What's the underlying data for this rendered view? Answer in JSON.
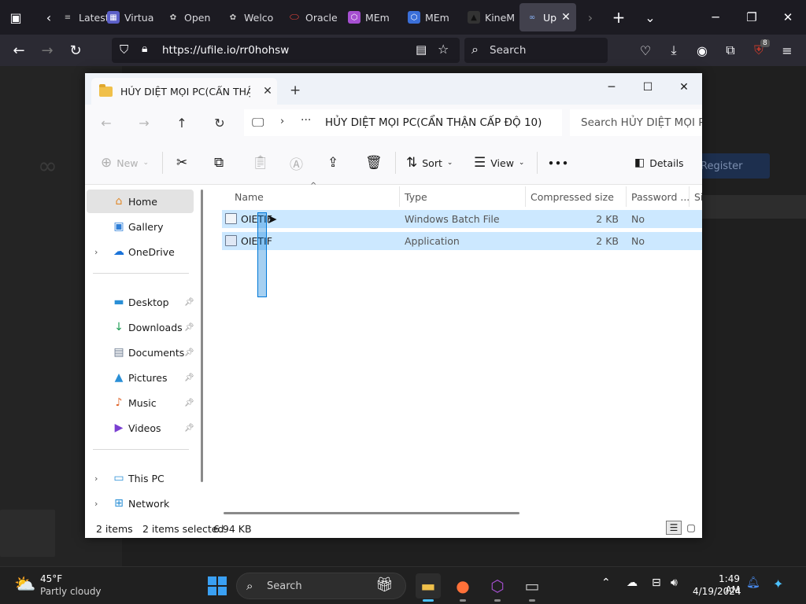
{
  "browser": {
    "tabs": [
      {
        "label": "Latest",
        "icon": "list-icon"
      },
      {
        "label": "Virtua",
        "icon": "virtualbox-icon"
      },
      {
        "label": "Open",
        "icon": "openai-icon"
      },
      {
        "label": "Welco",
        "icon": "openai-icon"
      },
      {
        "label": "Oracle",
        "icon": "oracle-icon"
      },
      {
        "label": "MEm",
        "icon": "memu-icon"
      },
      {
        "label": "MEm",
        "icon": "memu-icon"
      },
      {
        "label": "KineM",
        "icon": "kinemaster-icon"
      },
      {
        "label": "Up",
        "icon": "ufile-icon",
        "active": true
      }
    ],
    "url": "https://ufile.io/rr0hohsw",
    "search_placeholder": "Search",
    "extension_badge": "8",
    "accent": "#42414d"
  },
  "page_behind": {
    "register_label": "Register"
  },
  "explorer": {
    "tab_title": "HỦY DIỆT MỌI PC(CẨN THẬN",
    "path_text": "HỦY DIỆT MỌI PC(CẨN THẬN CẤP ĐỘ 10)",
    "search_placeholder": "Search HỦY DIỆT MỌI PC",
    "toolbar": {
      "new_label": "New",
      "sort_label": "Sort",
      "view_label": "View",
      "more_label": "•••",
      "details_label": "Details"
    },
    "sidebar": {
      "home": "Home",
      "gallery": "Gallery",
      "onedrive": "OneDrive",
      "desktop": "Desktop",
      "downloads": "Downloads",
      "documents": "Documents",
      "pictures": "Pictures",
      "music": "Music",
      "videos": "Videos",
      "thispc": "This PC",
      "network": "Network"
    },
    "columns": {
      "name": "Name",
      "type": "Type",
      "compressed": "Compressed size",
      "password": "Password ...",
      "size": "Si"
    },
    "files": [
      {
        "name": "OIETIF",
        "type": "Windows Batch File",
        "size": "2 KB",
        "password": "No"
      },
      {
        "name": "OIETIF",
        "type": "Application",
        "size": "2 KB",
        "password": "No"
      }
    ],
    "status": {
      "count": "2 items",
      "selected": "2 items selected",
      "selected_size": "6.94 KB"
    },
    "selection_color": "#cce8ff"
  },
  "taskbar": {
    "weather_temp": "45°F",
    "weather_desc": "Partly cloudy",
    "search_placeholder": "Search",
    "time": "1:49 AM",
    "date": "4/19/2024"
  }
}
